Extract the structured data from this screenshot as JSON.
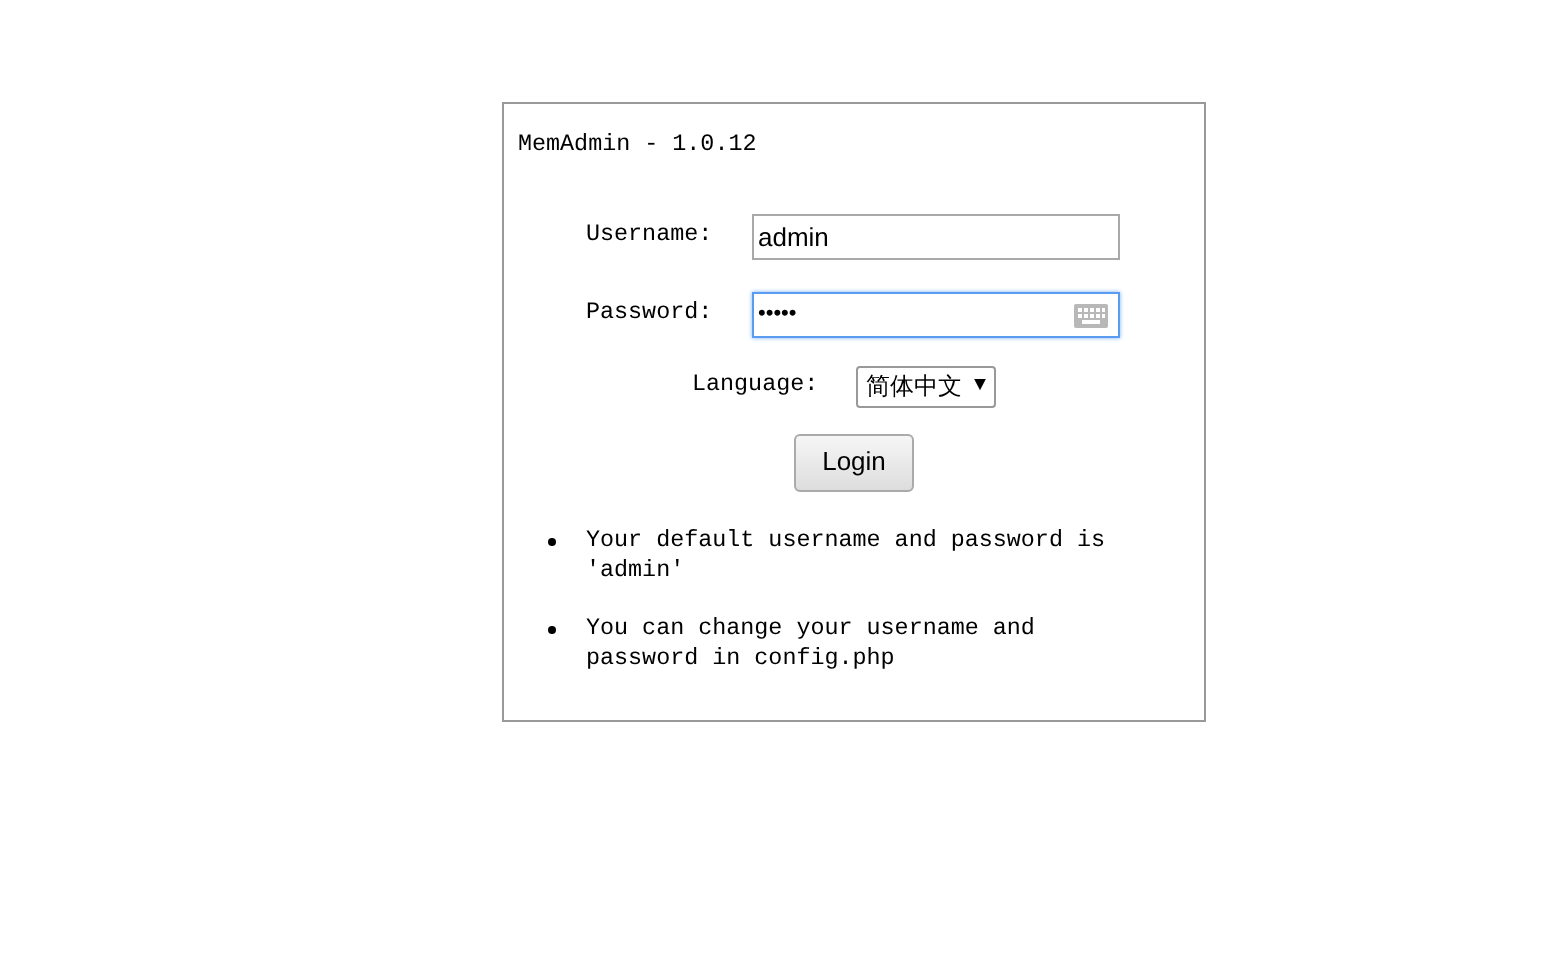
{
  "title": "MemAdmin - 1.0.12",
  "username": {
    "label": "Username:",
    "value": "admin",
    "focused": false
  },
  "password": {
    "label": "Password:",
    "value": "•••••",
    "focused": true
  },
  "language": {
    "label": "Language:",
    "value": "简体中文",
    "arrow": "▼"
  },
  "login_button": "Login",
  "notes": [
    "Your default username and password is 'admin'",
    "You can change your username and password in config.php"
  ]
}
